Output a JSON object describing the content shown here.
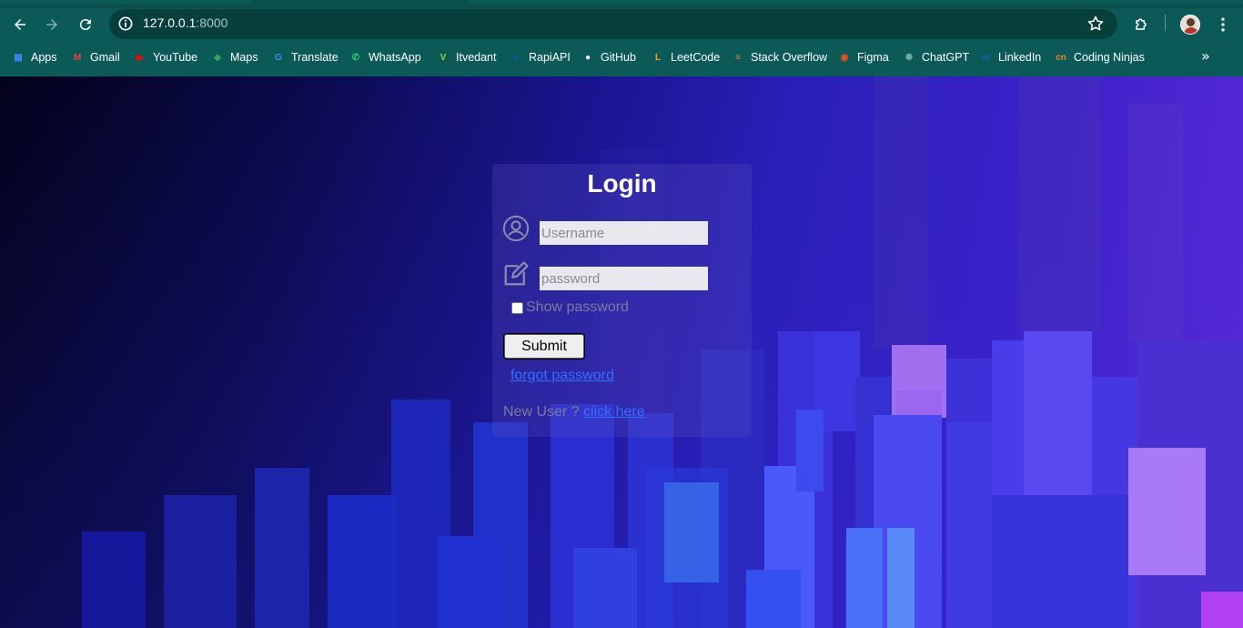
{
  "browser": {
    "url_host": "127.0.0.1",
    "url_port": ":8000",
    "bookmarks": [
      {
        "label": "Apps",
        "icon": "apps-grid-icon",
        "color": "#4285f4"
      },
      {
        "label": "Gmail",
        "icon": "gmail-icon",
        "color": "#ea4335"
      },
      {
        "label": "YouTube",
        "icon": "youtube-icon",
        "color": "#ff0000"
      },
      {
        "label": "Maps",
        "icon": "maps-icon",
        "color": "#34a853"
      },
      {
        "label": "Translate",
        "icon": "translate-icon",
        "color": "#4285f4"
      },
      {
        "label": "WhatsApp",
        "icon": "whatsapp-icon",
        "color": "#25d366"
      },
      {
        "label": "Itvedant",
        "icon": "itvedant-icon",
        "color": "#9acd32"
      },
      {
        "label": "RapiAPI",
        "icon": "rapiapi-icon",
        "color": "#0055ff"
      },
      {
        "label": "GitHub",
        "icon": "github-icon",
        "color": "#ffffff"
      },
      {
        "label": "LeetCode",
        "icon": "leetcode-icon",
        "color": "#ffa116"
      },
      {
        "label": "Stack Overflow",
        "icon": "stackoverflow-icon",
        "color": "#f48024"
      },
      {
        "label": "Figma",
        "icon": "figma-icon",
        "color": "#f24e1e"
      },
      {
        "label": "ChatGPT",
        "icon": "chatgpt-icon",
        "color": "#74aa9c"
      },
      {
        "label": "LinkedIn",
        "icon": "linkedin-icon",
        "color": "#0a66c2"
      },
      {
        "label": "Coding Ninjas",
        "icon": "codingninjas-icon",
        "color": "#f58220"
      }
    ]
  },
  "login": {
    "title": "Login",
    "username_placeholder": "Username",
    "password_placeholder": "password",
    "show_password_label": "Show password",
    "submit_label": "Submit",
    "forgot_label": "forgot password",
    "new_user_text": "New User ? ",
    "click_here_label": "click here"
  },
  "colors": {
    "chrome": "#0b5a57",
    "link": "#2f6fff"
  }
}
